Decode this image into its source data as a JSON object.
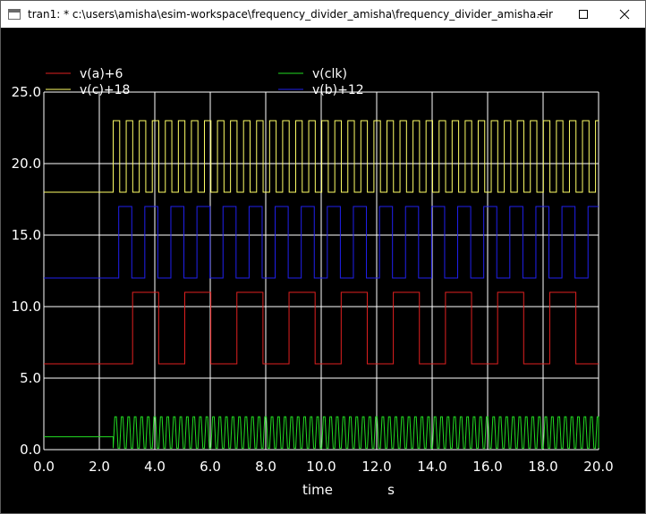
{
  "window": {
    "title": "tran1: * c:\\users\\amisha\\esim-workspace\\frequency_divider_amisha\\frequency_divider_amisha.cir",
    "icons": {
      "app": "window-icon",
      "minimize": "minimize-icon",
      "maximize": "maximize-icon",
      "close": "close-icon"
    }
  },
  "chart_data": {
    "type": "line",
    "xlabel": "time",
    "xunit": "s",
    "xlim": [
      0.0,
      20.0
    ],
    "ylim": [
      0.0,
      25.0
    ],
    "x_ticks": [
      "0.0",
      "2.0",
      "4.0",
      "6.0",
      "8.0",
      "10.0",
      "12.0",
      "14.0",
      "16.0",
      "18.0",
      "20.0"
    ],
    "y_ticks": [
      "0.0",
      "5.0",
      "10.0",
      "15.0",
      "20.0",
      "25.0"
    ],
    "grid": true,
    "legend_position": "top",
    "series": [
      {
        "name": "v(a)+6",
        "color": "#e02020",
        "kind": "square",
        "low": 6,
        "high": 11,
        "start": 3.2,
        "period": 1.88,
        "duty": 0.5,
        "pre_value": 6
      },
      {
        "name": "v(clk)",
        "color": "#22dd22",
        "kind": "clock",
        "low": 0.1,
        "high": 2.3,
        "start": 2.5,
        "period": 0.235,
        "pre_value": 0.9
      },
      {
        "name": "v(c)+18",
        "color": "#ffff66",
        "kind": "square",
        "low": 18,
        "high": 23,
        "start": 2.5,
        "period": 0.47,
        "duty": 0.5,
        "pre_value": 18
      },
      {
        "name": "v(b)+12",
        "color": "#2020ee",
        "kind": "square",
        "low": 12,
        "high": 17,
        "start": 2.7,
        "period": 0.94,
        "duty": 0.5,
        "pre_value": 12
      }
    ]
  }
}
